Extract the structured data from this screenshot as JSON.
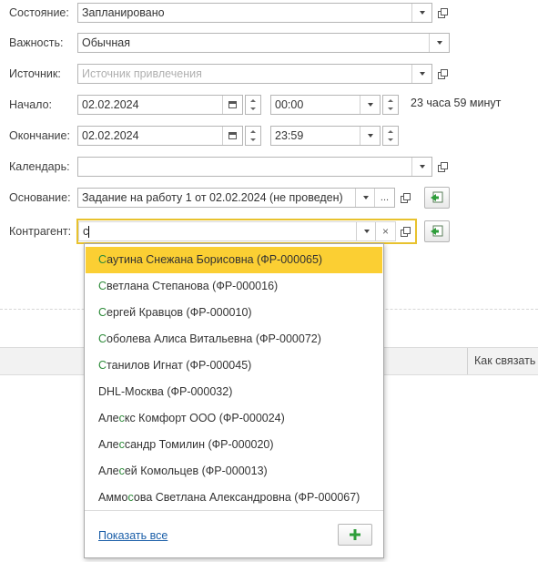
{
  "form": {
    "state": {
      "label": "Состояние:",
      "value": "Запланировано"
    },
    "importance": {
      "label": "Важность:",
      "value": "Обычная"
    },
    "source": {
      "label": "Источник:",
      "placeholder": "Источник привлечения"
    },
    "start": {
      "label": "Начало:",
      "date": "02.02.2024",
      "time": "00:00",
      "duration": "23 часа 59 минут"
    },
    "end": {
      "label": "Окончание:",
      "date": "02.02.2024",
      "time": "23:59"
    },
    "calendar": {
      "label": "Календарь:",
      "value": ""
    },
    "basis": {
      "label": "Основание:",
      "value": "Задание на работу 1 от 02.02.2024 (не проведен)",
      "dots": "..."
    },
    "counterparty": {
      "label": "Контрагент:",
      "value": "с",
      "clear": "×"
    }
  },
  "table_header": {
    "col_how_contact": "Как связать"
  },
  "dropdown": {
    "items": [
      {
        "pre": "",
        "match": "С",
        "post": "аутина Снежана Борисовна (ФР-000065)"
      },
      {
        "pre": "",
        "match": "С",
        "post": "ветлана Степанова (ФР-000016)"
      },
      {
        "pre": "",
        "match": "С",
        "post": "ергей Кравцов (ФР-000010)"
      },
      {
        "pre": "",
        "match": "С",
        "post": "оболева Алиса Витальевна (ФР-000072)"
      },
      {
        "pre": "",
        "match": "С",
        "post": "танилов Игнат (ФР-000045)"
      },
      {
        "pre": "DHL-Москва (ФР-000032)",
        "match": "",
        "post": ""
      },
      {
        "pre": "Але",
        "match": "с",
        "post": "кс Комфорт ООО (ФР-000024)"
      },
      {
        "pre": "Але",
        "match": "с",
        "post": "сандр Томилин (ФР-000020)"
      },
      {
        "pre": "Але",
        "match": "с",
        "post": "ей Комольцев (ФР-000013)"
      },
      {
        "pre": "Аммо",
        "match": "с",
        "post": "ова Светлана Александровна (ФР-000067)"
      }
    ],
    "show_all": "Показать все",
    "add_icon": "plus-icon",
    "selected_index": 0
  },
  "colors": {
    "accent": "#fbcf33",
    "match": "#2e8b3a",
    "focus_border": "#e8c22e",
    "link": "#1a5ea8",
    "plus": "#2e9e3a"
  }
}
